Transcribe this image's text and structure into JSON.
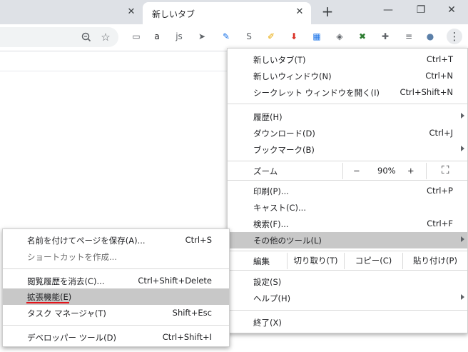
{
  "tabs": {
    "active_title": "新しいタブ",
    "close_glyph": "✕",
    "new_tab_glyph": "+"
  },
  "window_controls": {
    "minimize": "—",
    "maximize": "❐",
    "close": "✕"
  },
  "toolbar": {
    "zoom_icon": "zoom-icon",
    "star_glyph": "☆",
    "extensions": [
      {
        "name": "ext-page-icon",
        "glyph": "▭",
        "color": "#5f6368"
      },
      {
        "name": "ext-amazon-icon",
        "glyph": "a",
        "color": "#202124"
      },
      {
        "name": "ext-js-icon",
        "glyph": "js",
        "color": "#5f6368"
      },
      {
        "name": "ext-cursor-icon",
        "glyph": "➤",
        "color": "#5f6368"
      },
      {
        "name": "ext-eyedropper-icon",
        "glyph": "✎",
        "color": "#1a73e8"
      },
      {
        "name": "ext-skype-icon",
        "glyph": "S",
        "color": "#5f6368"
      },
      {
        "name": "ext-note-icon",
        "glyph": "✐",
        "color": "#e8a800"
      },
      {
        "name": "ext-download-icon",
        "glyph": "⬇",
        "color": "#d93025"
      },
      {
        "name": "ext-calendar-icon",
        "glyph": "▦",
        "color": "#1a73e8"
      },
      {
        "name": "ext-tag-icon",
        "glyph": "◈",
        "color": "#5f6368"
      },
      {
        "name": "ext-cross-icon",
        "glyph": "✖",
        "color": "#2e7d32"
      },
      {
        "name": "ext-puzzle-icon",
        "glyph": "✚",
        "color": "#5f6368"
      },
      {
        "name": "ext-playlist-icon",
        "glyph": "≡",
        "color": "#5f6368"
      },
      {
        "name": "ext-avatar-icon",
        "glyph": "●",
        "color": "#5b7fa8"
      },
      {
        "name": "ext-kebab-icon",
        "glyph": "⋮",
        "color": "#3c4043"
      }
    ]
  },
  "main_menu": {
    "new_tab": {
      "label": "新しいタブ(T)",
      "shortcut": "Ctrl+T"
    },
    "new_window": {
      "label": "新しいウィンドウ(N)",
      "shortcut": "Ctrl+N"
    },
    "incognito": {
      "label": "シークレット ウィンドウを開く(I)",
      "shortcut": "Ctrl+Shift+N"
    },
    "history": {
      "label": "履歴(H)"
    },
    "downloads": {
      "label": "ダウンロード(D)",
      "shortcut": "Ctrl+J"
    },
    "bookmarks": {
      "label": "ブックマーク(B)"
    },
    "zoom": {
      "label": "ズーム",
      "minus": "−",
      "value": "90%",
      "plus": "+",
      "fullscreen": "⛶"
    },
    "print": {
      "label": "印刷(P)...",
      "shortcut": "Ctrl+P"
    },
    "cast": {
      "label": "キャスト(C)..."
    },
    "find": {
      "label": "検索(F)...",
      "shortcut": "Ctrl+F"
    },
    "more_tools": {
      "label": "その他のツール(L)"
    },
    "edit": {
      "label": "編集",
      "cut": "切り取り(T)",
      "copy": "コピー(C)",
      "paste": "貼り付け(P)"
    },
    "settings": {
      "label": "設定(S)"
    },
    "help": {
      "label": "ヘルプ(H)"
    },
    "exit": {
      "label": "終了(X)"
    }
  },
  "sub_menu": {
    "save_page": {
      "label": "名前を付けてページを保存(A)...",
      "shortcut": "Ctrl+S"
    },
    "create_shortcut": {
      "label": "ショートカットを作成..."
    },
    "clear_history": {
      "label": "閲覧履歴を消去(C)...",
      "shortcut": "Ctrl+Shift+Delete"
    },
    "extensions": {
      "label": "拡張機能(E)"
    },
    "task_manager": {
      "label": "タスク マネージャ(T)",
      "shortcut": "Shift+Esc"
    },
    "dev_tools": {
      "label": "デベロッパー ツール(D)",
      "shortcut": "Ctrl+Shift+I"
    }
  },
  "colors": {
    "highlight": "#c8c8c8",
    "underline": "#e2141a"
  }
}
